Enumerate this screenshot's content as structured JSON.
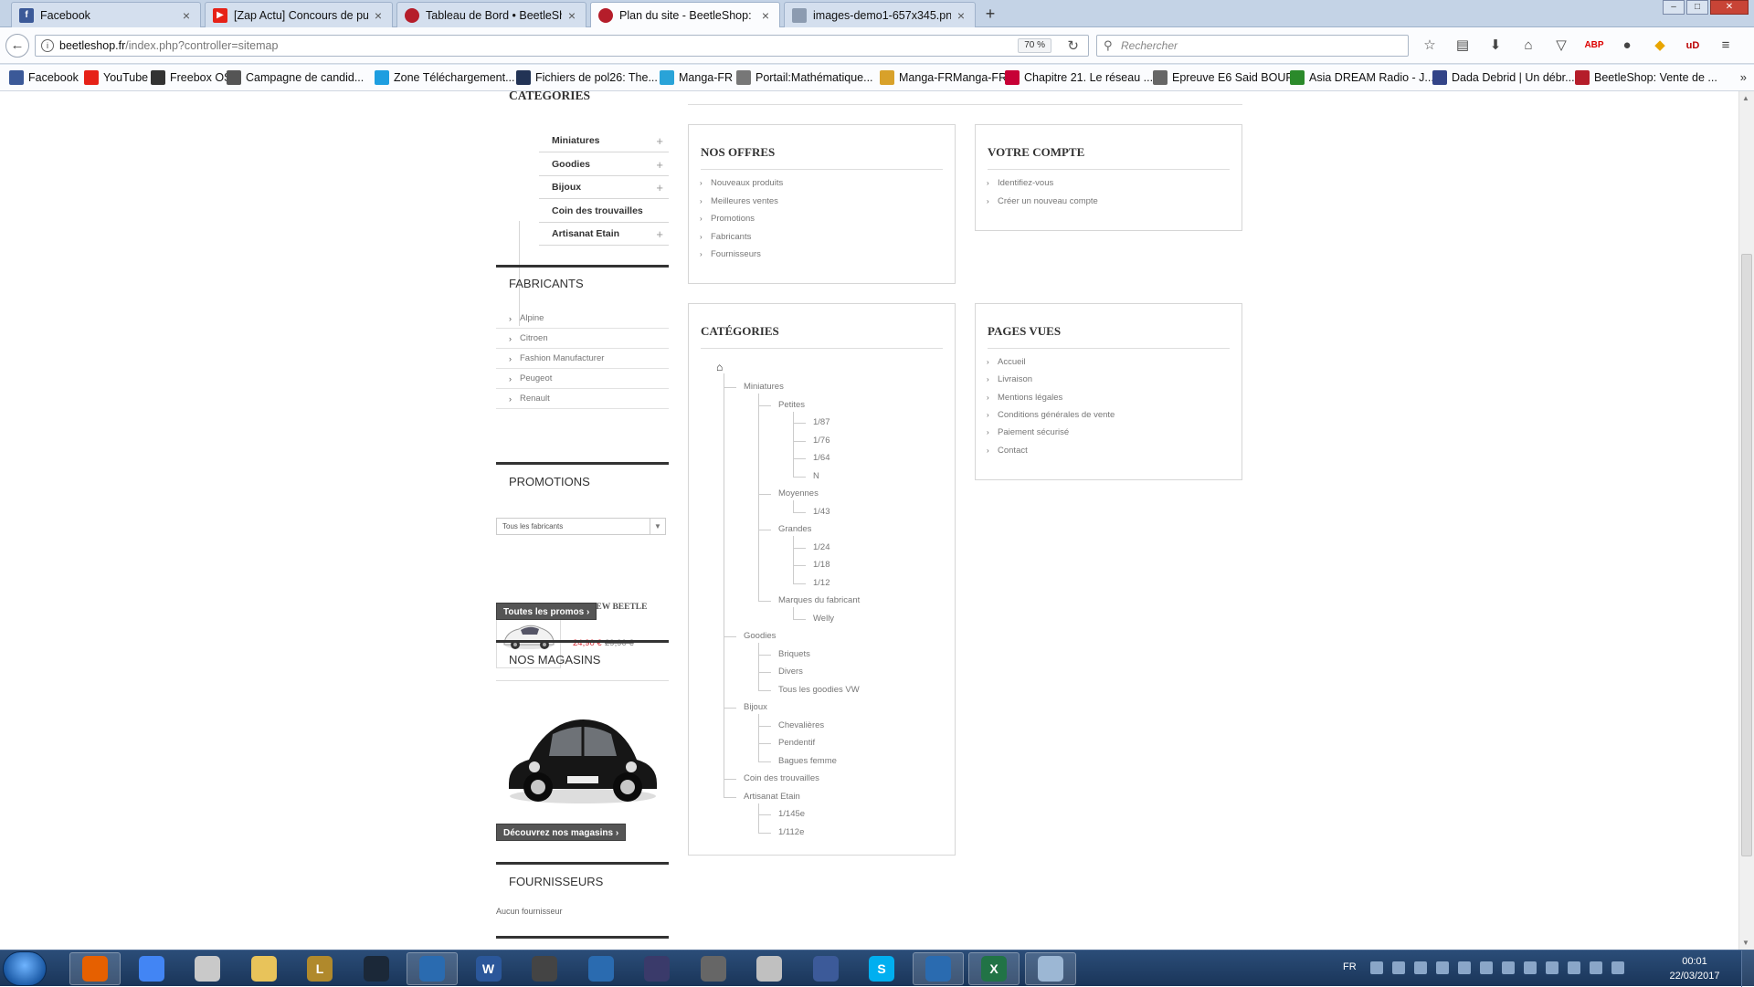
{
  "browser": {
    "tabs": [
      {
        "title": "Facebook",
        "icon": "facebook-icon",
        "color": "#3b5998"
      },
      {
        "title": "[Zap Actu] Concours de pu...",
        "icon": "youtube-icon",
        "color": "#e62117"
      },
      {
        "title": "Tableau de Bord • BeetleSh...",
        "icon": "beetleshop-icon",
        "color": "#b51d2a"
      },
      {
        "title": "Plan du site - BeetleShop: ...",
        "icon": "beetleshop-icon",
        "color": "#b51d2a"
      },
      {
        "title": "images-demo1-657x345.pn...",
        "icon": "image-file-icon",
        "color": "#8c9bb0"
      }
    ],
    "url_host": "beetleshop.fr",
    "url_path": "/index.php?controller=sitemap",
    "zoom": "70 %",
    "search_placeholder": "Rechercher",
    "bookmarks": [
      {
        "label": "Facebook",
        "icon": "facebook-icon",
        "color": "#3b5998"
      },
      {
        "label": "YouTube",
        "icon": "youtube-icon",
        "color": "#e62117"
      },
      {
        "label": "Freebox OS",
        "icon": "freebox-icon",
        "color": "#333333"
      },
      {
        "label": "Campagne de candid...",
        "icon": "pen-icon",
        "color": "#555555"
      },
      {
        "label": "Zone Téléchargement...",
        "icon": "download-zone-icon",
        "color": "#1e9ee0"
      },
      {
        "label": "Fichiers de pol26: The...",
        "icon": "files-icon",
        "color": "#223355"
      },
      {
        "label": "Manga-FR",
        "icon": "manga-icon",
        "color": "#29a3d8"
      },
      {
        "label": "Portail:Mathématique...",
        "icon": "wikipedia-icon",
        "color": "#777777"
      },
      {
        "label": "Manga-FRManga-FR",
        "icon": "manga-folder-icon",
        "color": "#d8a12a"
      },
      {
        "label": "Chapitre 21. Le réseau ...",
        "icon": "debian-icon",
        "color": "#c70036"
      },
      {
        "label": "Epreuve E6 Said BOUF...",
        "icon": "document-icon",
        "color": "#666666"
      },
      {
        "label": "Asia DREAM Radio - J...",
        "icon": "radio-icon",
        "color": "#2b8a2b"
      },
      {
        "label": "Dada Debrid | Un débr...",
        "icon": "debrid-icon",
        "color": "#334488"
      },
      {
        "label": "BeetleShop: Vente de ...",
        "icon": "beetleshop-icon",
        "color": "#b51d2a"
      }
    ]
  },
  "sidebar": {
    "categories_title": "CATÉGORIES",
    "categories": [
      {
        "label": "Miniatures",
        "expandable": true
      },
      {
        "label": "Goodies",
        "expandable": true
      },
      {
        "label": "Bijoux",
        "expandable": true
      },
      {
        "label": "Coin des trouvailles",
        "expandable": false
      },
      {
        "label": "Artisanat Etain",
        "expandable": true
      }
    ],
    "manufacturers_title": "FABRICANTS",
    "manufacturers": [
      "Alpine",
      "Citroen",
      "Fashion Manufacturer",
      "Peugeot",
      "Renault"
    ],
    "manufacturer_select": "Tous les fabricants",
    "promotions_title": "PROMOTIONS",
    "promo": {
      "name": "VW NEW BEETLE 2012",
      "price": "24,90 €",
      "old_price": "29,90 €"
    },
    "promos_button": "Toutes les promos",
    "stores_title": "NOS MAGASINS",
    "stores_button": "Découvrez nos magasins",
    "suppliers_title": "FOURNISSEURS",
    "suppliers_empty": "Aucun fournisseur"
  },
  "sitemap": {
    "offers_title": "NOS OFFRES",
    "offers": [
      "Nouveaux produits",
      "Meilleures ventes",
      "Promotions",
      "Fabricants",
      "Fournisseurs"
    ],
    "account_title": "VOTRE COMPTE",
    "account": [
      "Identifiez-vous",
      "Créer un nouveau compte"
    ],
    "categories_title": "CATÉGORIES",
    "tree": [
      {
        "label": "Miniatures",
        "level": 1
      },
      {
        "label": "Petites",
        "level": 2
      },
      {
        "label": "1/87",
        "level": 3
      },
      {
        "label": "1/76",
        "level": 3
      },
      {
        "label": "1/64",
        "level": 3
      },
      {
        "label": "N",
        "level": 3
      },
      {
        "label": "Moyennes",
        "level": 2
      },
      {
        "label": "1/43",
        "level": 3
      },
      {
        "label": "Grandes",
        "level": 2
      },
      {
        "label": "1/24",
        "level": 3
      },
      {
        "label": "1/18",
        "level": 3
      },
      {
        "label": "1/12",
        "level": 3
      },
      {
        "label": "Marques du fabricant",
        "level": 2
      },
      {
        "label": "Welly",
        "level": 3
      },
      {
        "label": "Goodies",
        "level": 1
      },
      {
        "label": "Briquets",
        "level": 2
      },
      {
        "label": "Divers",
        "level": 2
      },
      {
        "label": "Tous les goodies VW",
        "level": 2
      },
      {
        "label": "Bijoux",
        "level": 1
      },
      {
        "label": "Chevalières",
        "level": 2
      },
      {
        "label": "Pendentif",
        "level": 2
      },
      {
        "label": "Bagues femme",
        "level": 2
      },
      {
        "label": "Coin des trouvailles",
        "level": 1
      },
      {
        "label": "Artisanat Etain",
        "level": 1
      },
      {
        "label": "1/145e",
        "level": 2
      },
      {
        "label": "1/112e",
        "level": 2
      }
    ],
    "pages_title": "PAGES VUES",
    "pages": [
      "Accueil",
      "Livraison",
      "Mentions légales",
      "Conditions générales de vente",
      "Paiement sécurisé",
      "Contact"
    ]
  },
  "taskbar": {
    "apps": [
      {
        "name": "firefox",
        "glyph": "",
        "color": "#e66000",
        "active": true
      },
      {
        "name": "chrome",
        "glyph": "",
        "color": "#4285f4",
        "active": false
      },
      {
        "name": "clock-app",
        "glyph": "",
        "color": "#c9c9c9",
        "active": false
      },
      {
        "name": "explorer",
        "glyph": "",
        "color": "#e8c35a",
        "active": false
      },
      {
        "name": "league-of-legends",
        "glyph": "L",
        "color": "#b0892c",
        "active": false
      },
      {
        "name": "steam",
        "glyph": "",
        "color": "#1b2838",
        "active": false
      },
      {
        "name": "launcher",
        "glyph": "",
        "color": "#2a6bb0",
        "active": true
      },
      {
        "name": "word",
        "glyph": "W",
        "color": "#2b579a",
        "active": false
      },
      {
        "name": "app-9",
        "glyph": "",
        "color": "#444444",
        "active": false
      },
      {
        "name": "app-10",
        "glyph": "",
        "color": "#2a6bb0",
        "active": false
      },
      {
        "name": "app-11",
        "glyph": "",
        "color": "#3a3a6a",
        "active": false
      },
      {
        "name": "app-12",
        "glyph": "",
        "color": "#666666",
        "active": false
      },
      {
        "name": "app-13",
        "glyph": "",
        "color": "#c0c0c0",
        "active": false
      },
      {
        "name": "app-14",
        "glyph": "",
        "color": "#3c5a99",
        "active": false
      },
      {
        "name": "skype",
        "glyph": "S",
        "color": "#00aff0",
        "active": false
      },
      {
        "name": "launcher-2",
        "glyph": "",
        "color": "#2a6bb0",
        "active": true
      },
      {
        "name": "excel",
        "glyph": "X",
        "color": "#217346",
        "active": true
      },
      {
        "name": "paint",
        "glyph": "",
        "color": "#9cb7d4",
        "active": true
      }
    ],
    "lang": "FR",
    "time": "00:01",
    "date": "22/03/2017"
  }
}
